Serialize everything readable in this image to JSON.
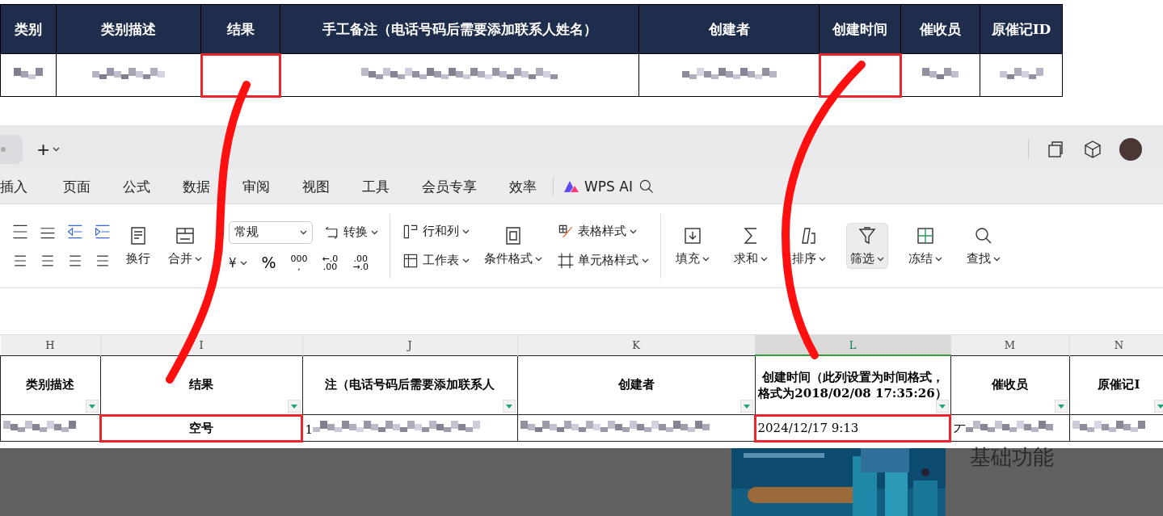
{
  "top_table": {
    "columns": [
      {
        "label": "类别",
        "redacted": true,
        "highlighted": false
      },
      {
        "label": "类别描述",
        "redacted": true,
        "highlighted": false
      },
      {
        "label": "结果",
        "redacted": false,
        "highlighted": true
      },
      {
        "label": "手工备注（电话号码后需要添加联系人姓名）",
        "redacted": true,
        "highlighted": false
      },
      {
        "label": "创建者",
        "redacted": true,
        "highlighted": false
      },
      {
        "label": "创建时间",
        "redacted": false,
        "highlighted": true
      },
      {
        "label": "催收员",
        "redacted": true,
        "highlighted": false
      },
      {
        "label": "原催记ID",
        "redacted": true,
        "highlighted": false
      }
    ]
  },
  "tab_bar": {
    "new_tab": "+"
  },
  "menu": {
    "items": [
      "插入",
      "页面",
      "公式",
      "数据",
      "审阅",
      "视图",
      "工具",
      "会员专享",
      "效率"
    ],
    "ai_label": "WPS AI"
  },
  "ribbon": {
    "wrap": "换行",
    "merge": "合并",
    "number_format": "常规",
    "currency": "¥",
    "number_buttons": [
      {
        "lines": [
          "%"
        ]
      },
      {
        "lines": [
          "000",
          ","
        ]
      },
      {
        "lines": [
          "←.0",
          ".00"
        ]
      },
      {
        "lines": [
          ".00",
          "→.0"
        ]
      }
    ],
    "convert": "转换",
    "rows_cols": "行和列",
    "worksheet": "工作表",
    "conditional": "条件格式",
    "table_style": "表格样式",
    "cell_style": "单元格样式",
    "tools": [
      {
        "label": "填充",
        "selected": false
      },
      {
        "label": "求和",
        "selected": false
      },
      {
        "label": "排序",
        "selected": false
      },
      {
        "label": "筛选",
        "selected": true
      },
      {
        "label": "冻结",
        "selected": false
      },
      {
        "label": "查找",
        "selected": false
      }
    ]
  },
  "sheet": {
    "columns": [
      {
        "letter": "H",
        "selected": false,
        "header": "类别描述",
        "redacted": true,
        "highlighted": false
      },
      {
        "letter": "I",
        "selected": false,
        "header": "结果",
        "value": "空号",
        "bold": true,
        "redacted": false,
        "highlighted": true
      },
      {
        "letter": "J",
        "selected": false,
        "header": "注（电话号码后需要添加联系人",
        "value": "1",
        "redacted": true,
        "highlighted": false
      },
      {
        "letter": "K",
        "selected": false,
        "header": "创建者",
        "redacted": true,
        "highlighted": false
      },
      {
        "letter": "L",
        "selected": true,
        "header": "创建时间（此列设置为时间格式，格式为2018/02/08 17:35:26）",
        "value": "2024/12/17 9:13",
        "bold": false,
        "redacted": false,
        "highlighted": true
      },
      {
        "letter": "M",
        "selected": false,
        "header": "催收员",
        "value": "丆",
        "redacted": true,
        "highlighted": false
      },
      {
        "letter": "N",
        "selected": false,
        "header": "原催记I",
        "redacted": true,
        "highlighted": false
      }
    ]
  },
  "background": {
    "heading": "基础功能"
  }
}
